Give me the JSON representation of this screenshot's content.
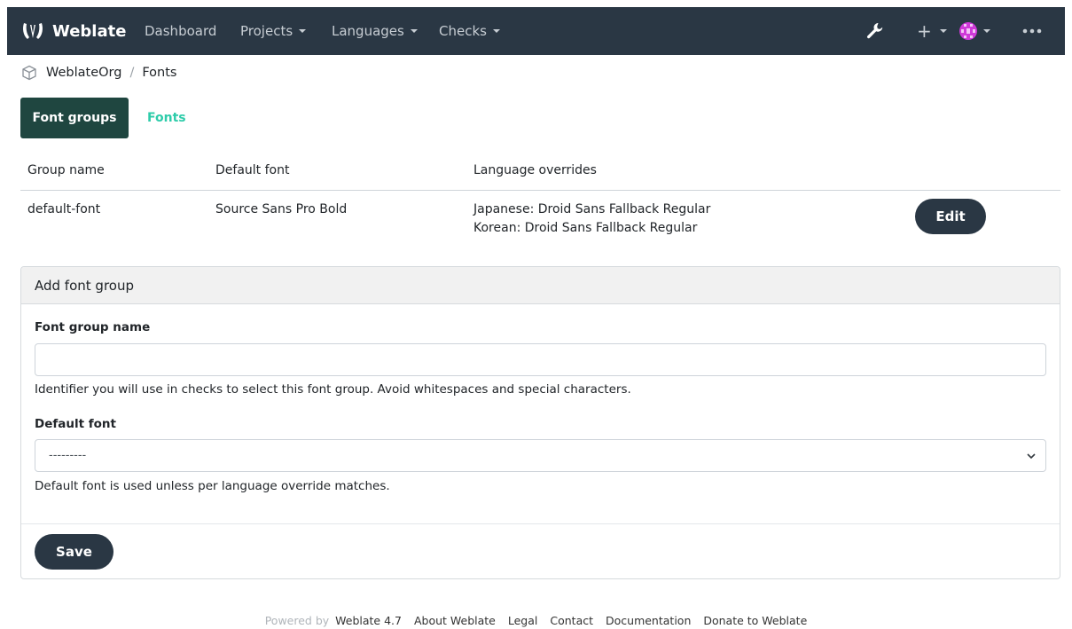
{
  "navbar": {
    "brand": "Weblate",
    "items": [
      {
        "label": "Dashboard"
      },
      {
        "label": "Projects"
      },
      {
        "label": "Languages"
      },
      {
        "label": "Checks"
      }
    ],
    "icons": [
      "wrench-icon",
      "plus-icon",
      "avatar-icon",
      "more-icon"
    ],
    "colors": {
      "background": "#2a3744",
      "text": "#c7cdd3"
    }
  },
  "breadcrumb": {
    "org": "WeblateOrg",
    "separator": "/",
    "page": "Fonts"
  },
  "tabs": {
    "active": "Font groups",
    "other": "Fonts"
  },
  "table": {
    "headers": [
      "Group name",
      "Default font",
      "Language overrides"
    ],
    "rows": [
      {
        "group_name": "default-font",
        "default_font": "Source Sans Pro Bold",
        "overrides": [
          "Japanese: Droid Sans Fallback Regular",
          "Korean: Droid Sans Fallback Regular"
        ],
        "edit_label": "Edit"
      }
    ]
  },
  "form": {
    "title": "Add font group",
    "name_label": "Font group name",
    "name_value": "",
    "name_help": "Identifier you will use in checks to select this font group. Avoid whitespaces and special characters.",
    "default_font_label": "Default font",
    "default_font_value": "---------",
    "default_font_help": "Default font is used unless per language override matches.",
    "save_label": "Save"
  },
  "footer": {
    "powered_by": "Powered by",
    "links": [
      "Weblate 4.7",
      "About Weblate",
      "Legal",
      "Contact",
      "Documentation",
      "Donate to Weblate"
    ]
  },
  "colors": {
    "accent": "#2eccaa",
    "tab_active_bg": "#1f4640",
    "button_bg": "#2a3744"
  }
}
